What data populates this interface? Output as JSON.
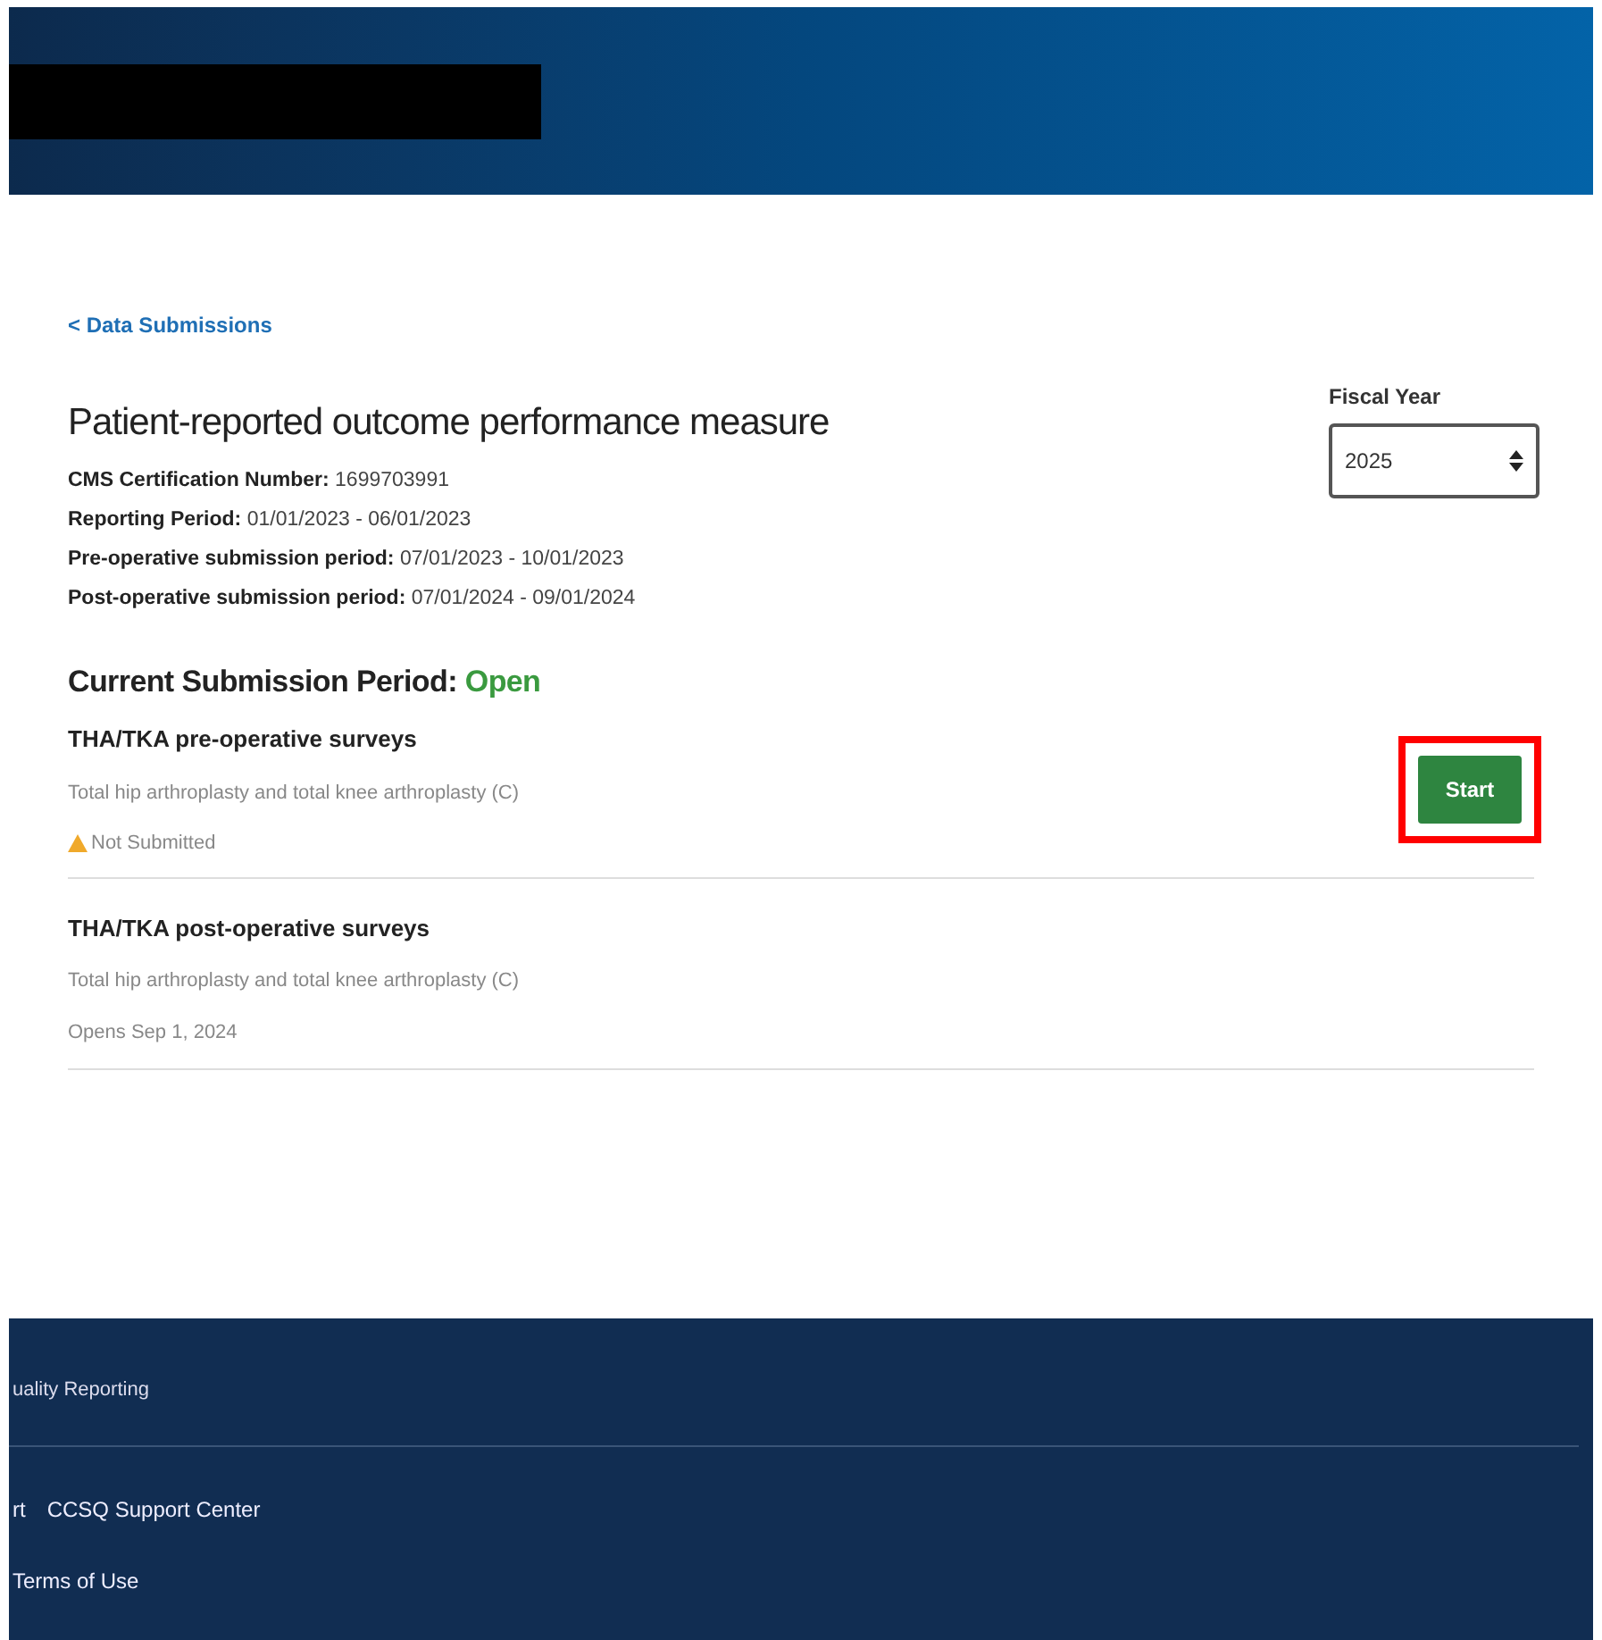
{
  "header": {
    "redacted": true
  },
  "back_link": "< Data Submissions",
  "title": "Patient-reported outcome performance measure",
  "details": [
    {
      "label": "CMS Certification Number:",
      "value": "1699703991"
    },
    {
      "label": "Reporting Period:",
      "value": "01/01/2023 - 06/01/2023"
    },
    {
      "label": "Pre-operative submission period:",
      "value": "07/01/2023 - 10/01/2023"
    },
    {
      "label": "Post-operative submission period:",
      "value": "07/01/2024 - 09/01/2024"
    }
  ],
  "fiscal_year": {
    "label": "Fiscal Year",
    "value": "2025"
  },
  "current_period": {
    "label": "Current Submission Period:",
    "status": "Open"
  },
  "surveys": [
    {
      "title": "THA/TKA pre-operative surveys",
      "description": "Total hip arthroplasty and total knee arthroplasty (C)",
      "status": "Not Submitted",
      "kind": "warning",
      "action": "Start",
      "highlighted": true
    },
    {
      "title": "THA/TKA post-operative surveys",
      "description": "Total hip arthroplasty and total knee arthroplasty (C)",
      "status": "Opens Sep 1, 2024",
      "kind": "plain"
    }
  ],
  "footer": {
    "heading": "uality Reporting",
    "links": [
      "rt",
      "CCSQ Support Center",
      "Terms of Use"
    ]
  }
}
